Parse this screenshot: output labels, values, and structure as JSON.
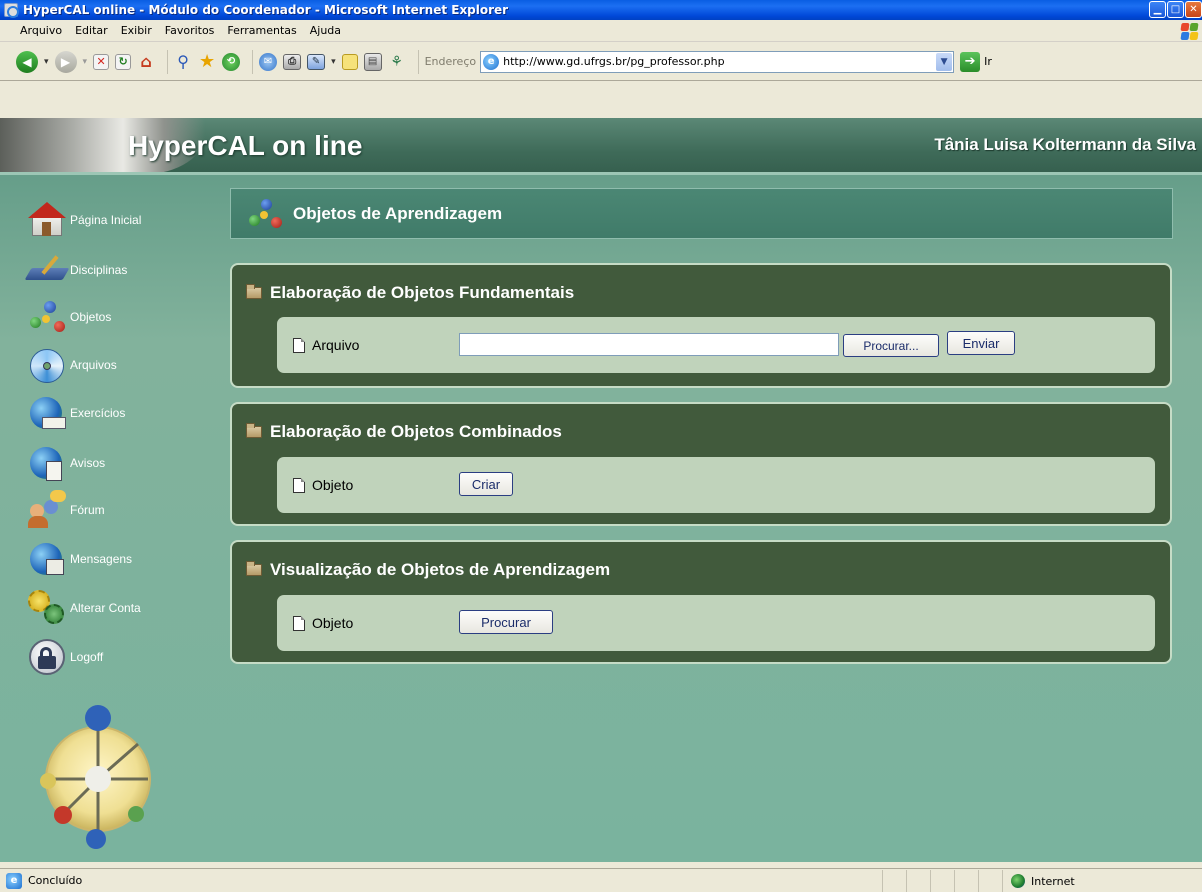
{
  "window": {
    "title": "HyperCAL online - Módulo do Coordenador - Microsoft Internet Explorer",
    "controls": [
      "minimize",
      "maximize",
      "close"
    ]
  },
  "menu": {
    "items": [
      "Arquivo",
      "Editar",
      "Exibir",
      "Favoritos",
      "Ferramentas",
      "Ajuda"
    ]
  },
  "toolbar": {
    "icons": [
      "back-icon",
      "forward-icon",
      "stop-icon",
      "refresh-icon",
      "home-icon",
      "search-icon",
      "favorites-icon",
      "history-icon",
      "mail-icon",
      "print-icon",
      "edit-icon",
      "discuss-icon",
      "messenger-icon",
      "research-icon"
    ],
    "address_label": "Endereço",
    "address_value": "http://www.gd.ufrgs.br/pg_professor.php",
    "go_label": "Ir"
  },
  "header": {
    "title": "HyperCAL on line",
    "user": "Tânia Luisa Koltermann da Silva"
  },
  "sidebar": {
    "items": [
      {
        "label": "Página Inicial",
        "icon": "home-icon"
      },
      {
        "label": "Disciplinas",
        "icon": "book-icon"
      },
      {
        "label": "Objetos",
        "icon": "molecule-icon"
      },
      {
        "label": "Arquivos",
        "icon": "cd-icon"
      },
      {
        "label": "Exercícios",
        "icon": "globe-pencil-icon"
      },
      {
        "label": "Avisos",
        "icon": "globe-doc-icon"
      },
      {
        "label": "Fórum",
        "icon": "users-chat-icon"
      },
      {
        "label": "Mensagens",
        "icon": "globe-mail-icon"
      },
      {
        "label": "Alterar Conta",
        "icon": "gears-icon"
      },
      {
        "label": "Logoff",
        "icon": "lock-icon"
      }
    ]
  },
  "main": {
    "section_title": "Objetos de Aprendizagem",
    "panels": [
      {
        "title": "Elaboração de Objetos Fundamentais",
        "field_label": "Arquivo",
        "file_value": "",
        "browse_label": "Procurar...",
        "submit_label": "Enviar"
      },
      {
        "title": "Elaboração de Objetos Combinados",
        "field_label": "Objeto",
        "action_label": "Criar"
      },
      {
        "title": "Visualização de Objetos de Aprendizagem",
        "field_label": "Objeto",
        "action_label": "Procurar"
      }
    ]
  },
  "statusbar": {
    "status": "Concluído",
    "zone": "Internet"
  }
}
